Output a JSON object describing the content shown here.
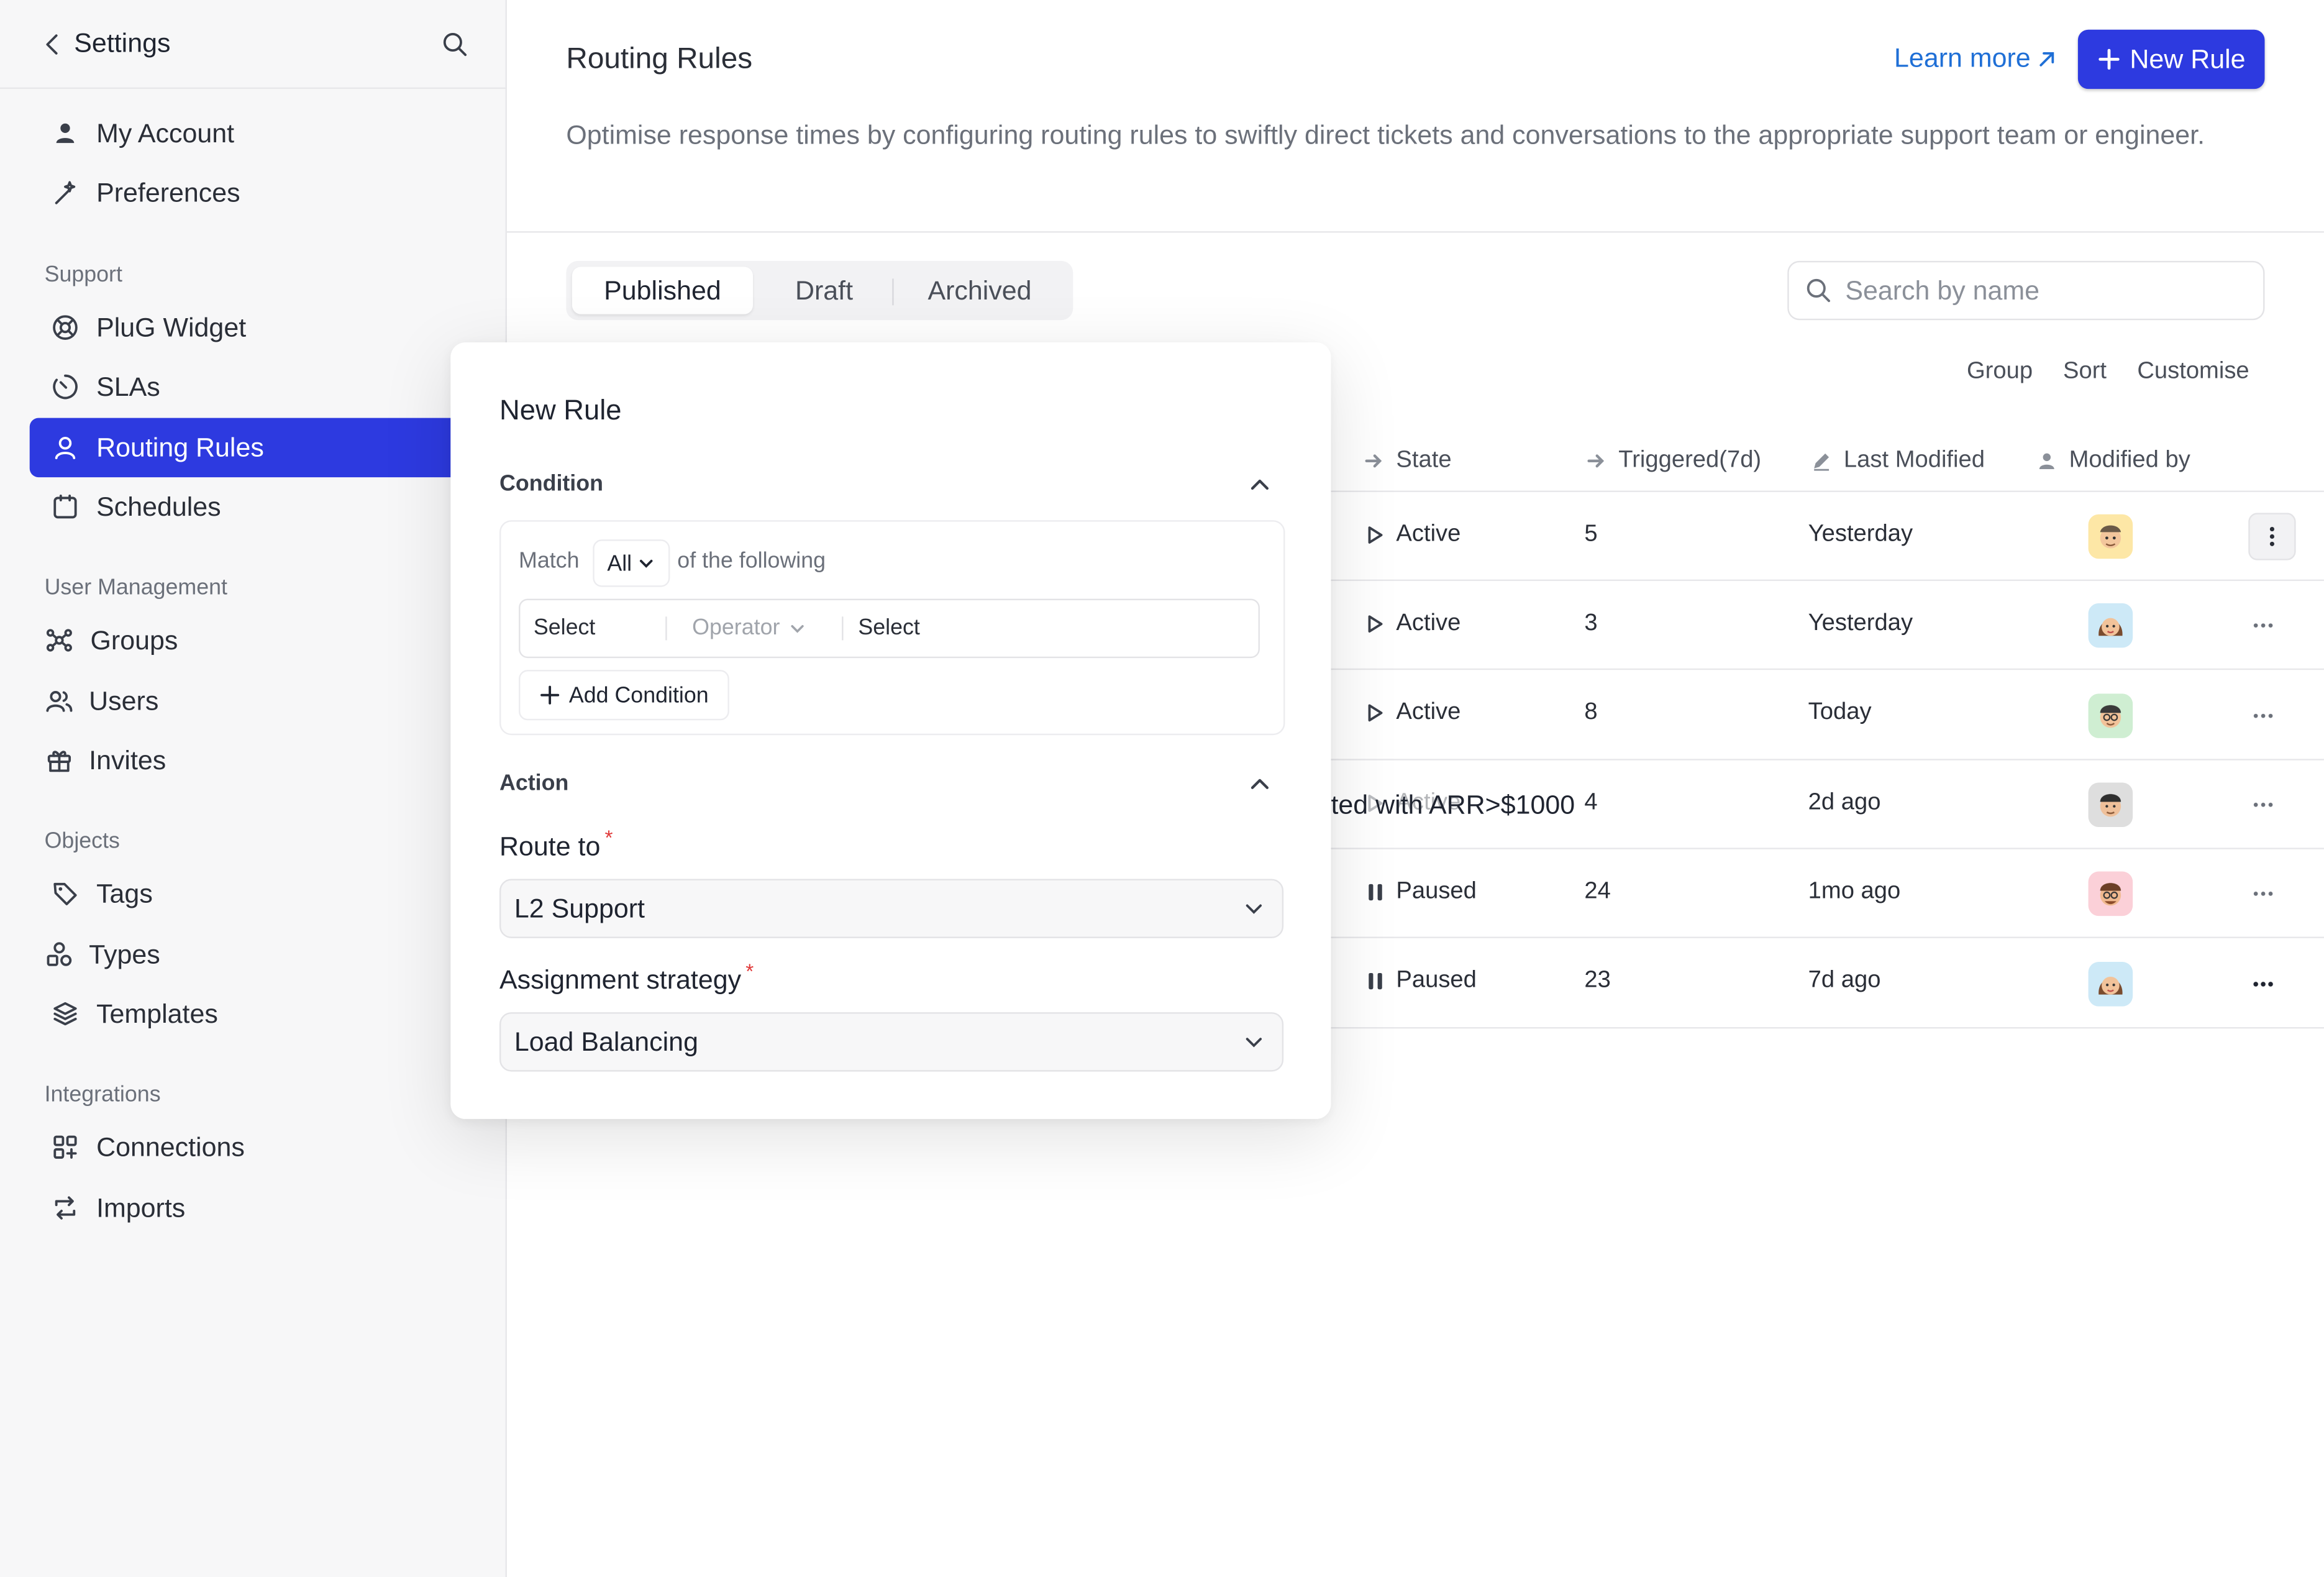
{
  "sidebar": {
    "title": "Settings",
    "items_top": [
      {
        "label": "My Account",
        "icon": "user-icon"
      },
      {
        "label": "Preferences",
        "icon": "magic-wand-icon"
      }
    ],
    "sections": [
      {
        "heading": "Support",
        "items": [
          {
            "label": "PluG Widget",
            "icon": "lifebuoy-icon"
          },
          {
            "label": "SLAs",
            "icon": "timer-icon"
          },
          {
            "label": "Routing Rules",
            "icon": "route-user-icon",
            "active": true
          },
          {
            "label": "Schedules",
            "icon": "calendar-icon"
          }
        ]
      },
      {
        "heading": "User Management",
        "items": [
          {
            "label": "Groups",
            "icon": "groups-icon"
          },
          {
            "label": "Users",
            "icon": "users-icon"
          },
          {
            "label": "Invites",
            "icon": "gift-icon"
          }
        ]
      },
      {
        "heading": "Objects",
        "items": [
          {
            "label": "Tags",
            "icon": "tag-icon"
          },
          {
            "label": "Types",
            "icon": "shapes-icon"
          },
          {
            "label": "Templates",
            "icon": "layers-icon"
          }
        ]
      },
      {
        "heading": "Integrations",
        "items": [
          {
            "label": "Connections",
            "icon": "grid-plus-icon"
          },
          {
            "label": "Imports",
            "icon": "sync-icon"
          }
        ]
      }
    ]
  },
  "header": {
    "title": "Routing Rules",
    "learn_more": "Learn more",
    "new_rule": "New Rule",
    "description": "Optimise response times by configuring routing rules to swiftly direct tickets and conversations to the appropriate support team or engineer."
  },
  "tabs": [
    "Published",
    "Draft",
    "Archived"
  ],
  "search": {
    "placeholder": "Search by name"
  },
  "toolbar": {
    "group": "Group",
    "sort": "Sort",
    "customise": "Customise"
  },
  "table": {
    "columns": [
      "State",
      "Triggered(7d)",
      "Last Modified",
      "Modified by"
    ],
    "rows": [
      {
        "state": "Active",
        "triggered": "5",
        "modified": "Yesterday"
      },
      {
        "state": "Active",
        "triggered": "3",
        "modified": "Yesterday"
      },
      {
        "state": "Active",
        "triggered": "8",
        "modified": "Today"
      },
      {
        "state": "Active",
        "triggered": "4",
        "modified": "2d ago"
      },
      {
        "state": "Paused",
        "triggered": "24",
        "modified": "1mo ago"
      },
      {
        "state": "Paused",
        "triggered": "23",
        "modified": "7d ago"
      }
    ],
    "overflow_name_fragment": "ted with ARR>$1000"
  },
  "popover": {
    "title": "New Rule",
    "condition": {
      "heading": "Condition",
      "match": "Match",
      "match_value": "All",
      "of_following": "of the following",
      "field": "Select",
      "operator": "Operator",
      "value": "Select",
      "add": "Add Condition"
    },
    "action": {
      "heading": "Action",
      "route_label": "Route to",
      "route_value": "L2 Support",
      "strategy_label": "Assignment strategy",
      "strategy_value": "Load Balancing",
      "required_mark": "*"
    }
  },
  "colors": {
    "accent": "#2d3ae0",
    "link": "#1f6fd6",
    "avatar_bgs": [
      "#fde7a6",
      "#cde9f7",
      "#cfeed2",
      "#dedede",
      "#fbd0d8",
      "#cde9f7"
    ]
  }
}
